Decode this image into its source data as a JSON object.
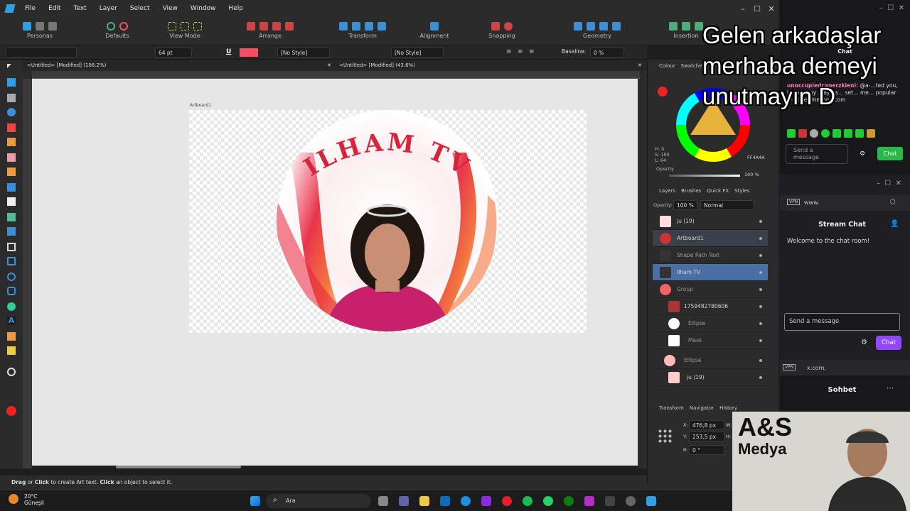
{
  "menu": {
    "items": [
      "File",
      "Edit",
      "Text",
      "Layer",
      "Select",
      "View",
      "Window",
      "Help"
    ]
  },
  "toolbar": {
    "groups": [
      "Personas",
      "Defaults",
      "View Mode",
      "Arrange",
      "Transform",
      "Alignment",
      "Snapping",
      "Geometry",
      "Insertion"
    ]
  },
  "context": {
    "font_size": "64 pt",
    "style1": "[No Style]",
    "style2": "[No Style]",
    "baseline_label": "Baseline:",
    "baseline_value": "0 %",
    "text_color": "#f25060"
  },
  "tabs": [
    {
      "label": "<Untitled> [Modified] (106.2%)"
    },
    {
      "label": "<Untitled> [Modified] (43.6%)"
    }
  ],
  "artboard": {
    "label": "Artboard1",
    "title_text": "ILHAM TV"
  },
  "colour_panel": {
    "tabs": [
      "Colour",
      "Swatches"
    ],
    "h": "H: 0",
    "s": "S: 100",
    "l": "L: 64",
    "hex": "FF4A4A",
    "opacity_label": "Opacity",
    "opacity_value": "100 %"
  },
  "layers_panel": {
    "tabs": [
      "Layers",
      "Brushes",
      "Quick FX",
      "Styles"
    ],
    "opacity_label": "Opacity:",
    "opacity_value": "100 %",
    "blend": "Normal",
    "layers": [
      "ju (19)",
      "Artboard1",
      "Shape Path Text",
      "Ilham TV",
      "Group",
      "1759482780606",
      "Ellipse",
      "Mask",
      "Ellipse",
      "ju (19)"
    ]
  },
  "transform_panel": {
    "tabs": [
      "Transform",
      "Navigator",
      "History"
    ],
    "x": "476,8 px",
    "y": "253,5 px",
    "r": "0 °",
    "x_label": "X:",
    "y_label": "Y:",
    "r_label": "R:",
    "w_label": "W:",
    "h_label": "H:"
  },
  "status": {
    "drag": "Drag",
    "or": " or ",
    "click": "Click",
    "mid": " to create Art text. ",
    "click2": "Click",
    "end": " an object to select it."
  },
  "chat1": {
    "title": "Chat",
    "username": "unoccupiedcaperzkieni:",
    "message": "@a-…ted you, I see many …eyers… set… me… popular — https://nezhna.com",
    "placeholder": "Send a message",
    "button": "Chat"
  },
  "chat2": {
    "url": "www.",
    "title": "Stream Chat",
    "welcome": "Welcome to the chat room!",
    "placeholder": "Send a message",
    "button": "Chat",
    "vpn": "VPN"
  },
  "chat3": {
    "url": "x.com,",
    "title": "Sohbet",
    "vpn": "VPN"
  },
  "overlay": {
    "line1": "Gelen arkadaşlar",
    "line2": "merhaba demeyi",
    "line3": "unutmayın D"
  },
  "webcam": {
    "logo1": "A&S",
    "logo2": "Medya"
  },
  "taskbar": {
    "weather_temp": "20°C",
    "weather_city": "Güneşli",
    "search": "Ara"
  }
}
